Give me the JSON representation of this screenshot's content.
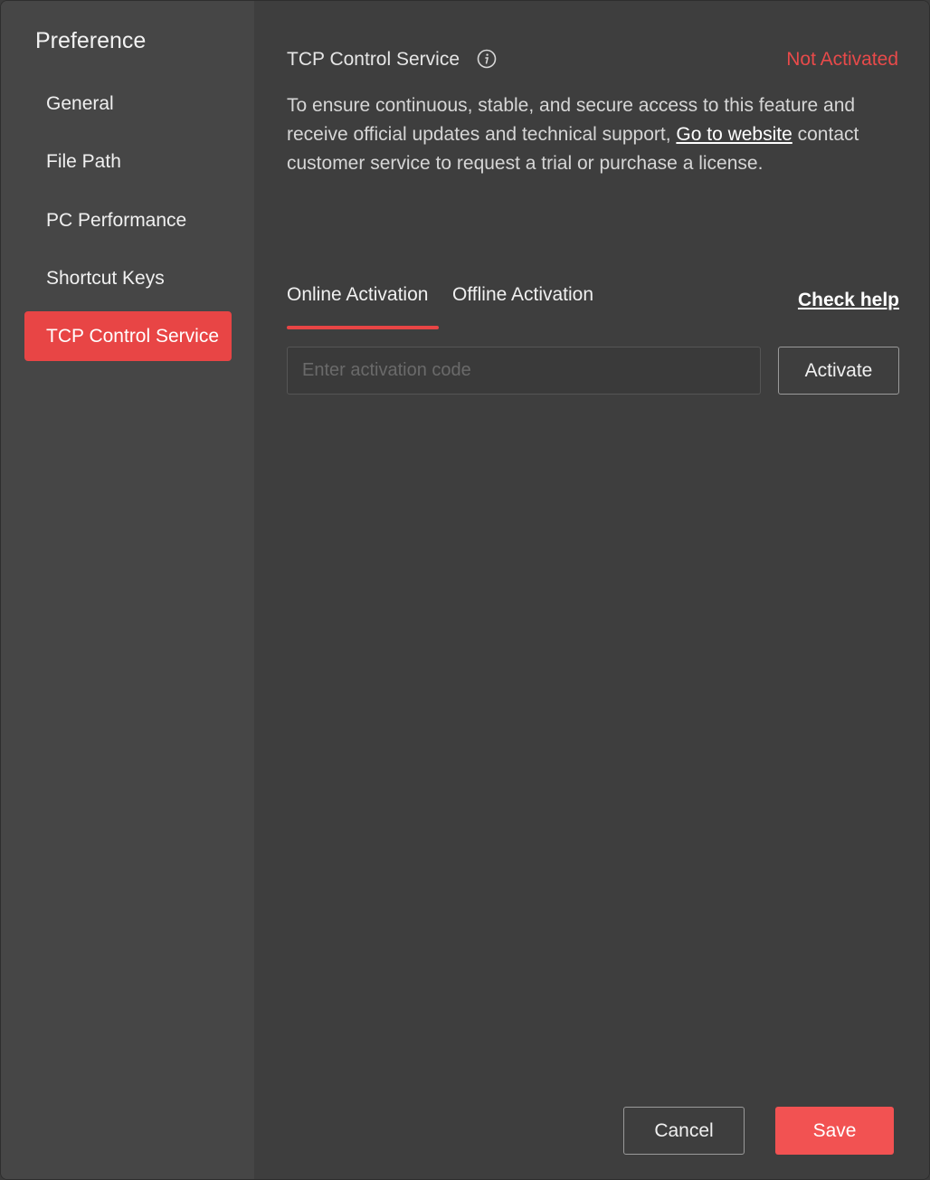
{
  "sidebar": {
    "title": "Preference",
    "items": [
      {
        "label": "General"
      },
      {
        "label": "File Path"
      },
      {
        "label": "PC Performance"
      },
      {
        "label": "Shortcut Keys"
      },
      {
        "label": "TCP Control Service",
        "active": true
      }
    ]
  },
  "main": {
    "section_title": "TCP Control Service",
    "info_icon": "info-icon",
    "status": "Not Activated",
    "status_color": "#e84a4a",
    "description": {
      "before_link": "To ensure continuous, stable, and secure access to this feature and receive official updates and technical support, ",
      "link": "Go to website",
      "after_link": " contact customer service to request a trial or purchase a license."
    },
    "tabs": [
      {
        "label": "Online Activation",
        "selected": true
      },
      {
        "label": "Offline Activation",
        "selected": false
      }
    ],
    "check_help": "Check help",
    "activation": {
      "placeholder": "Enter activation code",
      "value": "",
      "button": "Activate"
    }
  },
  "footer": {
    "cancel": "Cancel",
    "save": "Save"
  },
  "colors": {
    "accent": "#e84545",
    "save_button": "#f25252"
  }
}
